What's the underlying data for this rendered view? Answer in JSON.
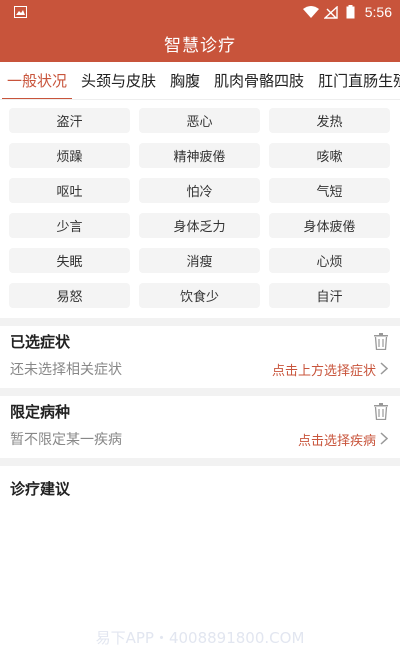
{
  "status_bar": {
    "time": "5:56"
  },
  "app_bar": {
    "title": "智慧诊疗"
  },
  "tabs": [
    {
      "label": "一般状况",
      "active": true
    },
    {
      "label": "头颈与皮肤",
      "active": false
    },
    {
      "label": "胸腹",
      "active": false
    },
    {
      "label": "肌肉骨骼四肢",
      "active": false
    },
    {
      "label": "肛门直肠生殖",
      "active": false
    }
  ],
  "symptoms": [
    "盗汗",
    "恶心",
    "发热",
    "烦躁",
    "精神疲倦",
    "咳嗽",
    "呕吐",
    "怕冷",
    "气短",
    "少言",
    "身体乏力",
    "身体疲倦",
    "失眠",
    "消瘦",
    "心烦",
    "易怒",
    "饮食少",
    "自汗"
  ],
  "selected_section": {
    "title": "已选症状",
    "empty_text": "还未选择相关症状",
    "action": "点击上方选择症状"
  },
  "disease_section": {
    "title": "限定病种",
    "empty_text": "暂不限定某一疾病",
    "action": "点击选择疾病"
  },
  "advice_section": {
    "title": "诊疗建议"
  },
  "watermark": "易下APP・4008891800.COM",
  "colors": {
    "brand": "#c8543b",
    "chip_bg": "#f4f4f4",
    "divider": "#f2f2f2"
  }
}
